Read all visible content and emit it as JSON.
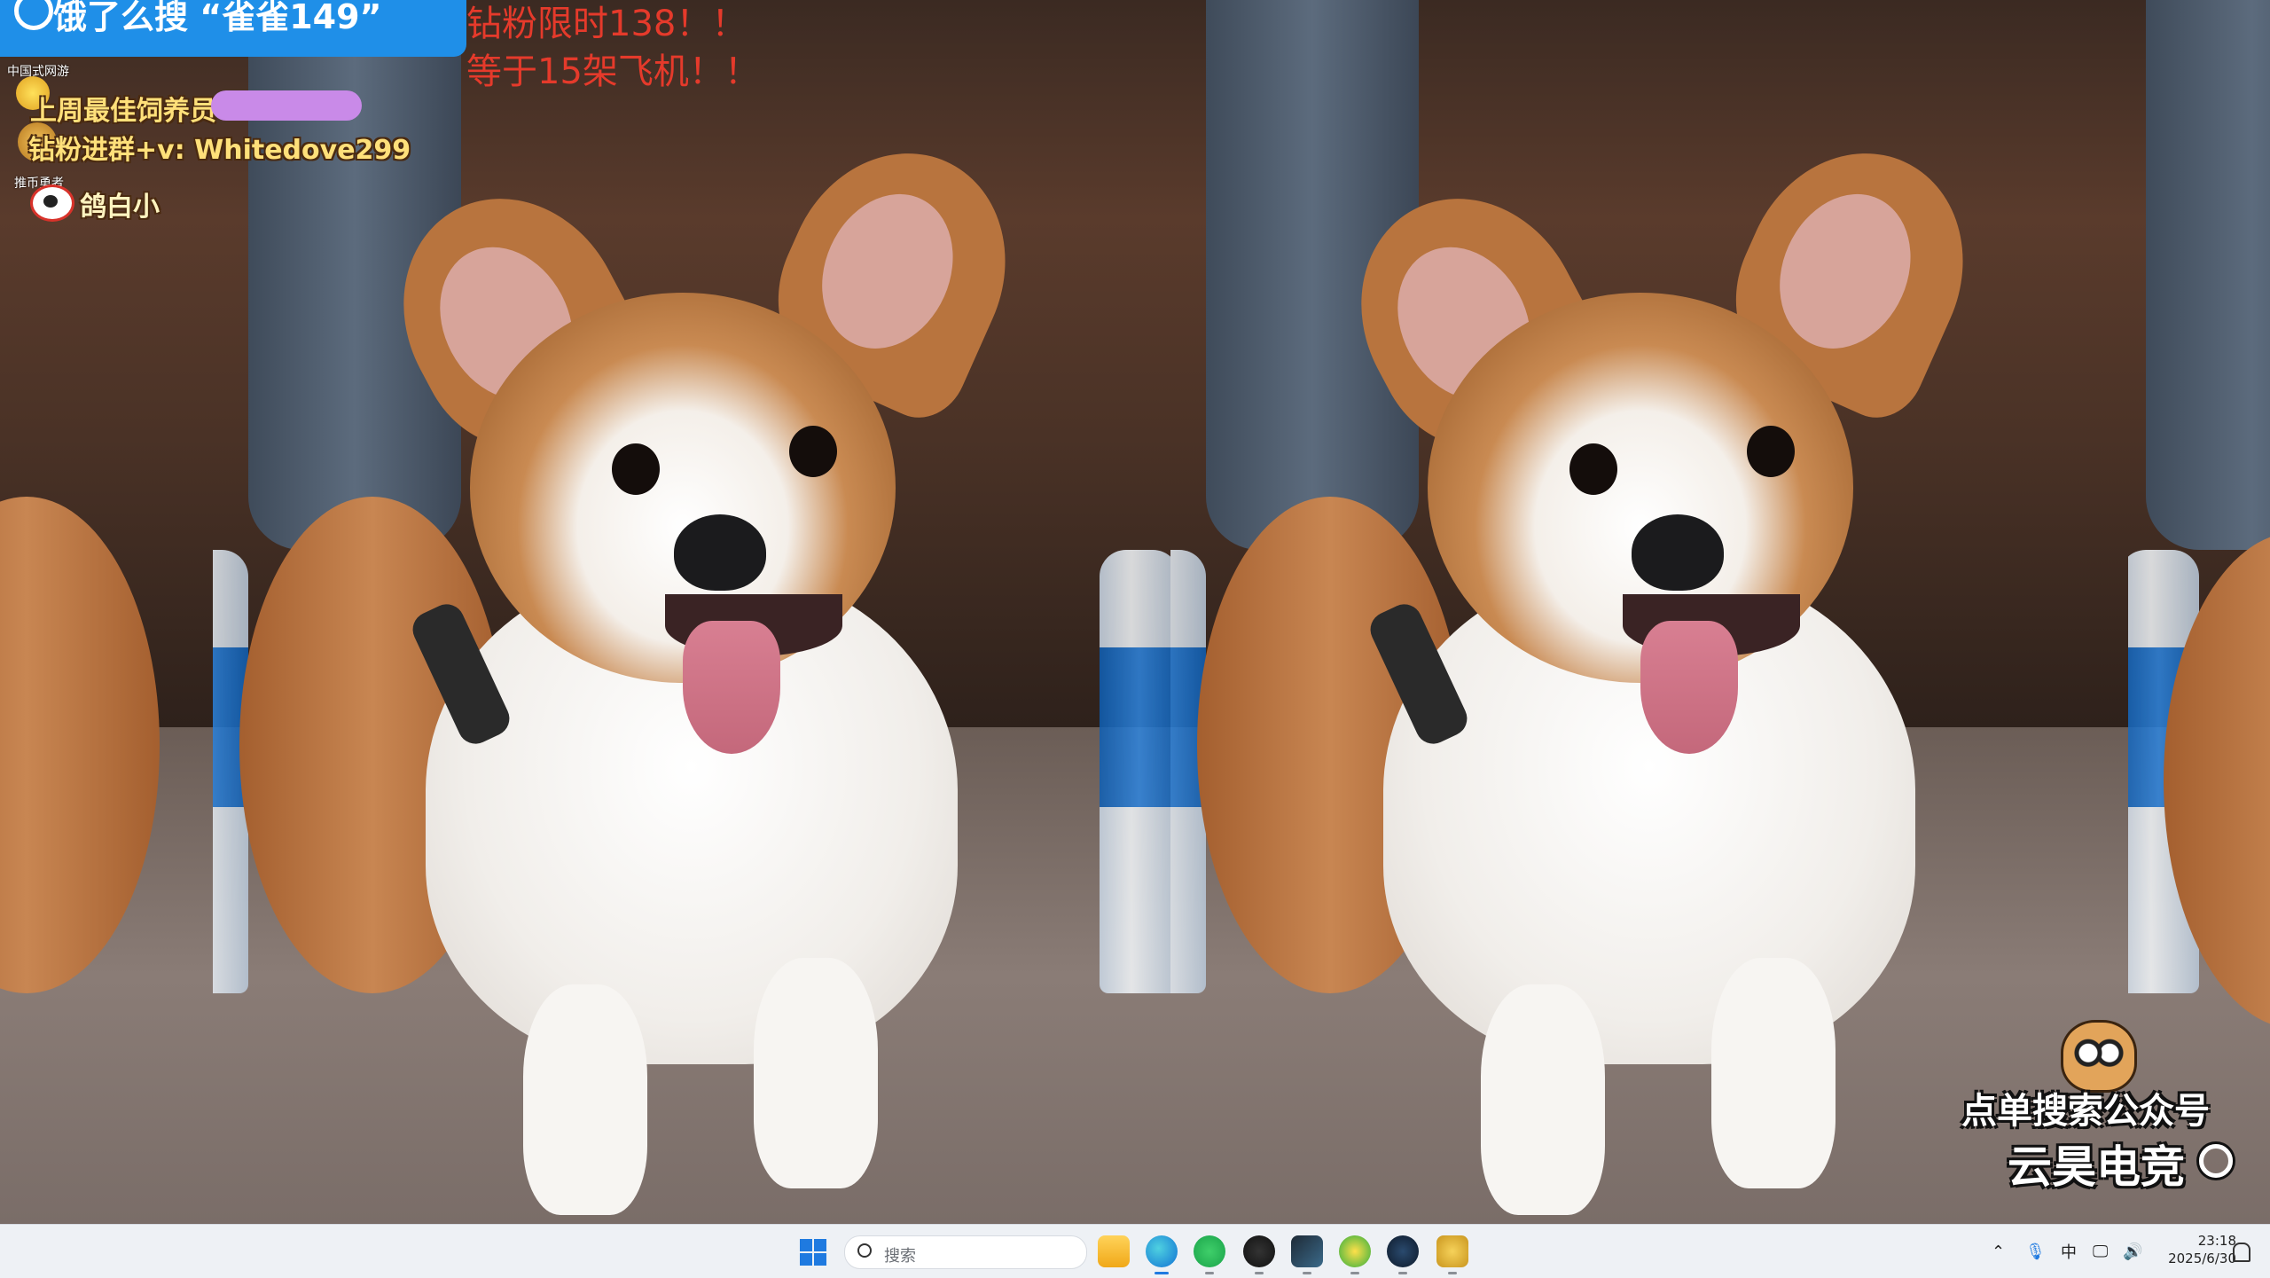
{
  "overlay": {
    "ad_banner": "饿了么搜 “雀雀149”",
    "promo_line1": "钻粉限时138！！",
    "promo_line2": "等于15架飞机！！",
    "small_label_1": "中国式网游",
    "best_member": "上周最佳饲养员",
    "diamond_join": "钻粉进群+v: Whitedove299",
    "small_label_2": "推币勇者",
    "weibo_name": "鸽白小"
  },
  "watermark": {
    "line1": "点单搜索公众号",
    "line2": "云昊电竞"
  },
  "taskbar": {
    "search_placeholder": "搜索",
    "apps": [
      "file-explorer-icon",
      "edge-icon",
      "wechat-icon",
      "netease-music-icon",
      "terminal-icon",
      "xbox-icon",
      "steam-icon",
      "owl-app-icon"
    ],
    "ime": "中",
    "time": "23:18",
    "date": "2025/6/30"
  },
  "colors": {
    "promo_red": "#e53a2b",
    "banner_blue": "#1f8fe8",
    "outline_gold": "#ffe07a"
  }
}
